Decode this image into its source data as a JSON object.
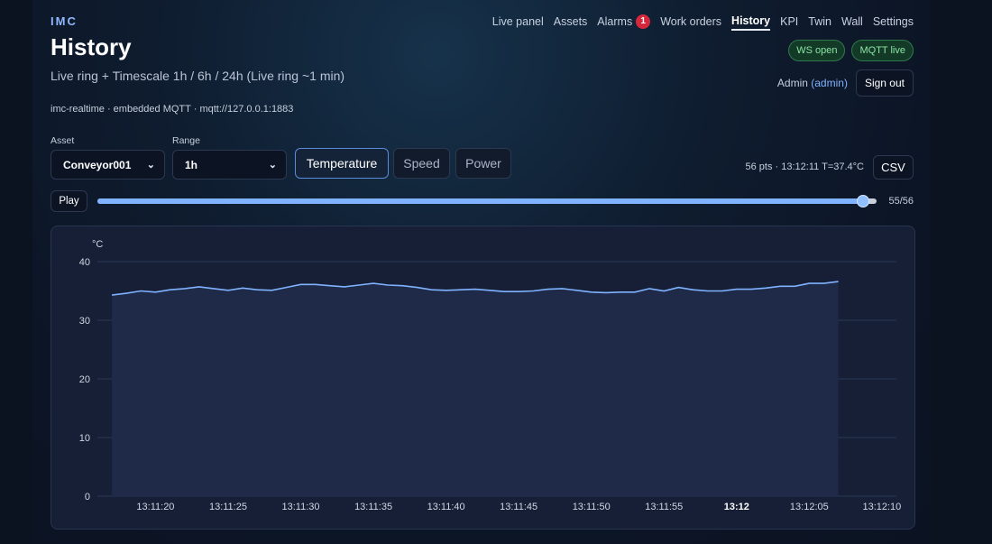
{
  "header": {
    "brand": "IMC",
    "title": "History",
    "subtitle": "Live ring + Timescale 1h / 6h / 24h (Live ring ~1 min)",
    "meta": "imc-realtime · embedded MQTT · mqtt://127.0.0.1:1883"
  },
  "nav": {
    "live_panel": "Live panel",
    "assets": "Assets",
    "alarms": "Alarms",
    "alarms_badge": "1",
    "work_orders": "Work orders",
    "history": "History",
    "kpi": "KPI",
    "twin": "Twin",
    "wall": "Wall",
    "settings": "Settings"
  },
  "status": {
    "ws": "WS open",
    "mqtt": "MQTT live"
  },
  "user": {
    "name": "Admin",
    "role": "(admin)",
    "signout": "Sign out"
  },
  "controls": {
    "asset_label": "Asset",
    "asset_value": "Conveyor001",
    "range_label": "Range",
    "range_value": "1h",
    "metrics": {
      "temperature": "Temperature",
      "speed": "Speed",
      "power": "Power"
    },
    "stats": "56 pts · 13:12:11 T=37.4°C",
    "csv": "CSV",
    "play": "Play",
    "position": 55,
    "total": 56,
    "count_label": "55/56"
  },
  "colors": {
    "accent": "#7fb2ff",
    "series": "#7fb2ff",
    "area": "#1e2a48",
    "alarm": "#d6283c",
    "ok": "#8de3a4"
  },
  "chart_data": {
    "type": "area",
    "ylabel": "°C",
    "ylim": [
      0,
      40
    ],
    "yticks": [
      0,
      10,
      20,
      30,
      40
    ],
    "xlim": [
      "13:11:16",
      "13:12:11"
    ],
    "xticks": [
      "13:11:20",
      "13:11:25",
      "13:11:30",
      "13:11:35",
      "13:11:40",
      "13:11:45",
      "13:11:50",
      "13:11:55",
      "13:12",
      "13:12:05",
      "13:12:10"
    ],
    "xticks_bold": [
      "13:12"
    ],
    "grid": true,
    "x_start": "13:11:17",
    "values": [
      34.3,
      34.6,
      35.0,
      34.8,
      35.2,
      35.4,
      35.7,
      35.4,
      35.1,
      35.5,
      35.2,
      35.1,
      35.6,
      36.1,
      36.1,
      35.9,
      35.7,
      36.0,
      36.3,
      36.0,
      35.9,
      35.6,
      35.2,
      35.1,
      35.2,
      35.3,
      35.1,
      34.9,
      34.9,
      35.0,
      35.3,
      35.4,
      35.1,
      34.8,
      34.7,
      34.8,
      34.8,
      35.4,
      35.0,
      35.6,
      35.2,
      35.0,
      35.0,
      35.3,
      35.3,
      35.5,
      35.8,
      35.8,
      36.3,
      36.3,
      36.6
    ]
  }
}
